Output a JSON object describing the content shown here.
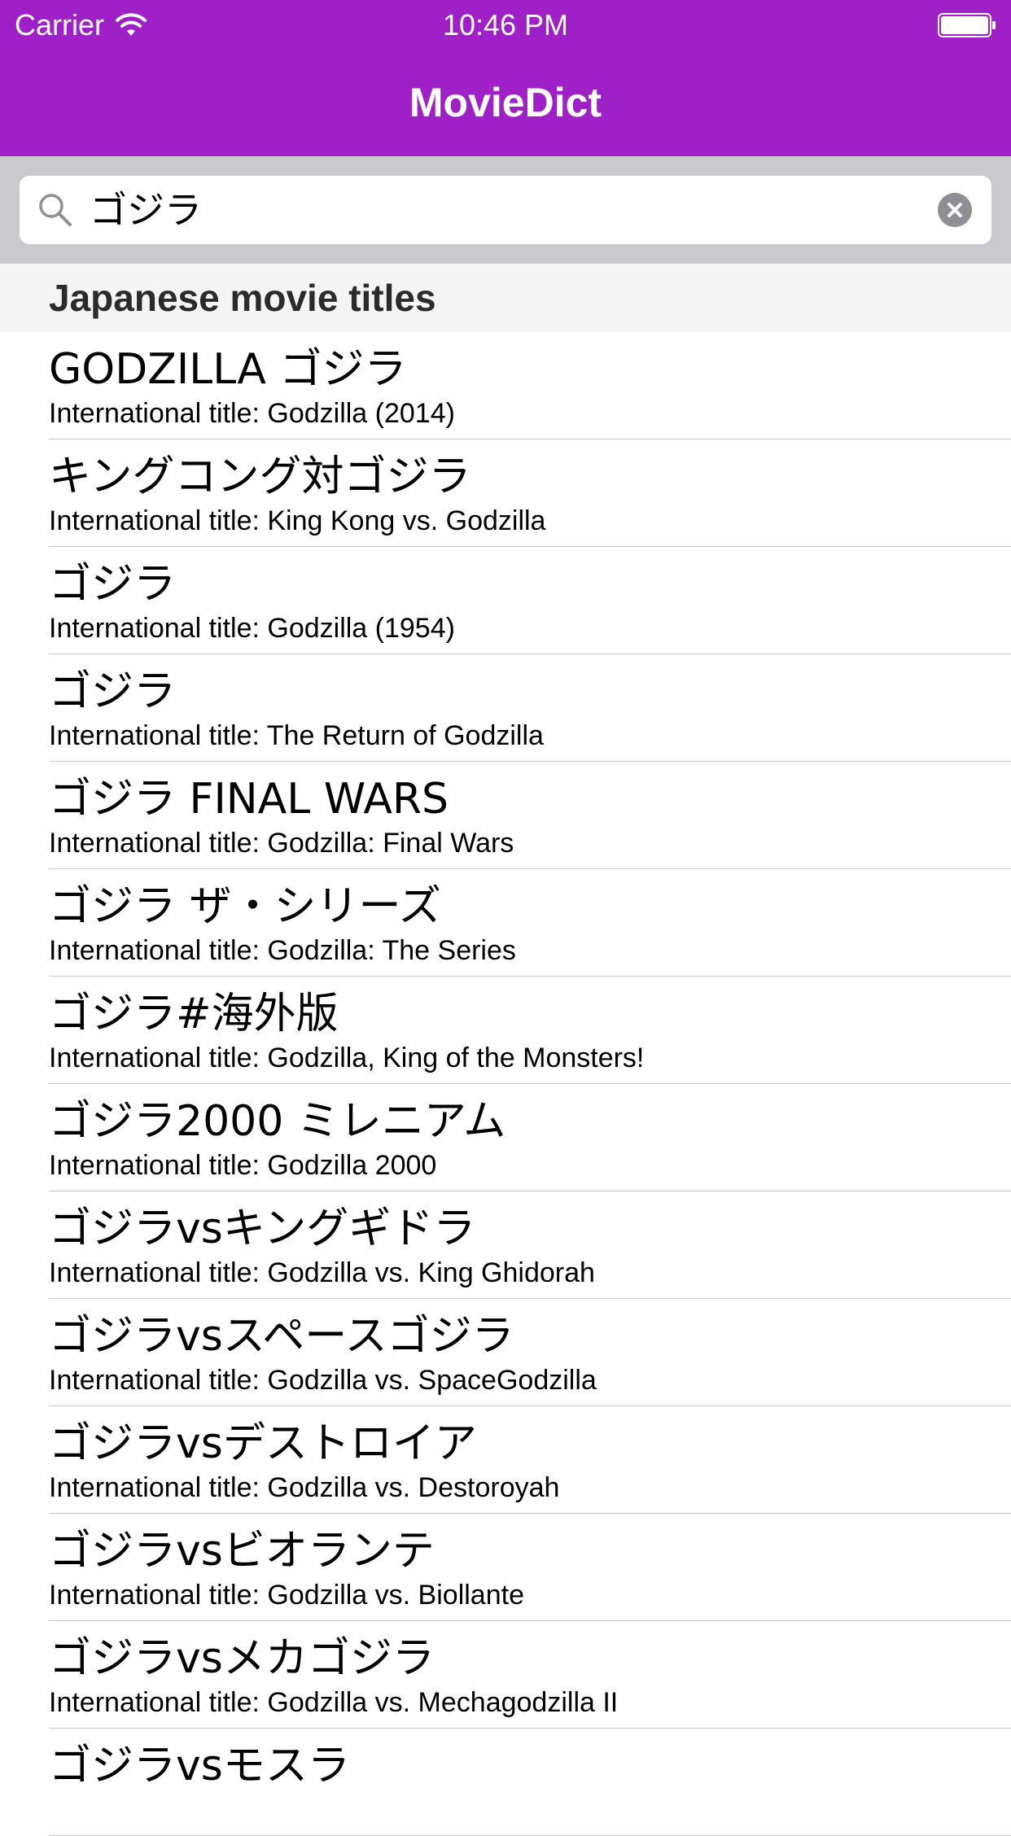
{
  "status_bar": {
    "carrier": "Carrier",
    "time": "10:46 PM"
  },
  "nav": {
    "title": "MovieDict"
  },
  "search": {
    "value": "ゴジラ",
    "placeholder": ""
  },
  "section": {
    "title": "Japanese movie titles"
  },
  "results": [
    {
      "title": "GODZILLA ゴジラ",
      "subtitle": "International title: Godzilla (2014)"
    },
    {
      "title": "キングコング対ゴジラ",
      "subtitle": "International title: King Kong vs. Godzilla"
    },
    {
      "title": "ゴジラ",
      "subtitle": "International title: Godzilla (1954)"
    },
    {
      "title": "ゴジラ",
      "subtitle": "International title: The Return of Godzilla"
    },
    {
      "title": "ゴジラ FINAL WARS",
      "subtitle": "International title: Godzilla: Final Wars"
    },
    {
      "title": "ゴジラ ザ・シリーズ",
      "subtitle": "International title: Godzilla: The Series"
    },
    {
      "title": "ゴジラ#海外版",
      "subtitle": "International title: Godzilla, King of the Monsters!"
    },
    {
      "title": "ゴジラ2000 ミレニアム",
      "subtitle": "International title: Godzilla 2000"
    },
    {
      "title": "ゴジラvsキングギドラ",
      "subtitle": "International title: Godzilla vs. King Ghidorah"
    },
    {
      "title": "ゴジラvsスペースゴジラ",
      "subtitle": "International title: Godzilla vs. SpaceGodzilla"
    },
    {
      "title": "ゴジラvsデストロイア",
      "subtitle": "International title: Godzilla vs. Destoroyah"
    },
    {
      "title": "ゴジラvsビオランテ",
      "subtitle": "International title: Godzilla vs. Biollante"
    },
    {
      "title": "ゴジラvsメカゴジラ",
      "subtitle": "International title: Godzilla vs. Mechagodzilla II"
    },
    {
      "title": "ゴジラvsモスラ",
      "subtitle": ""
    }
  ],
  "colors": {
    "nav_background": "#a020c8",
    "search_region": "#c9c9ce",
    "section_background": "#f4f4f5"
  },
  "icons": {
    "wifi": "wifi-icon",
    "battery": "battery-icon",
    "search": "search-icon",
    "clear": "clear-icon"
  }
}
